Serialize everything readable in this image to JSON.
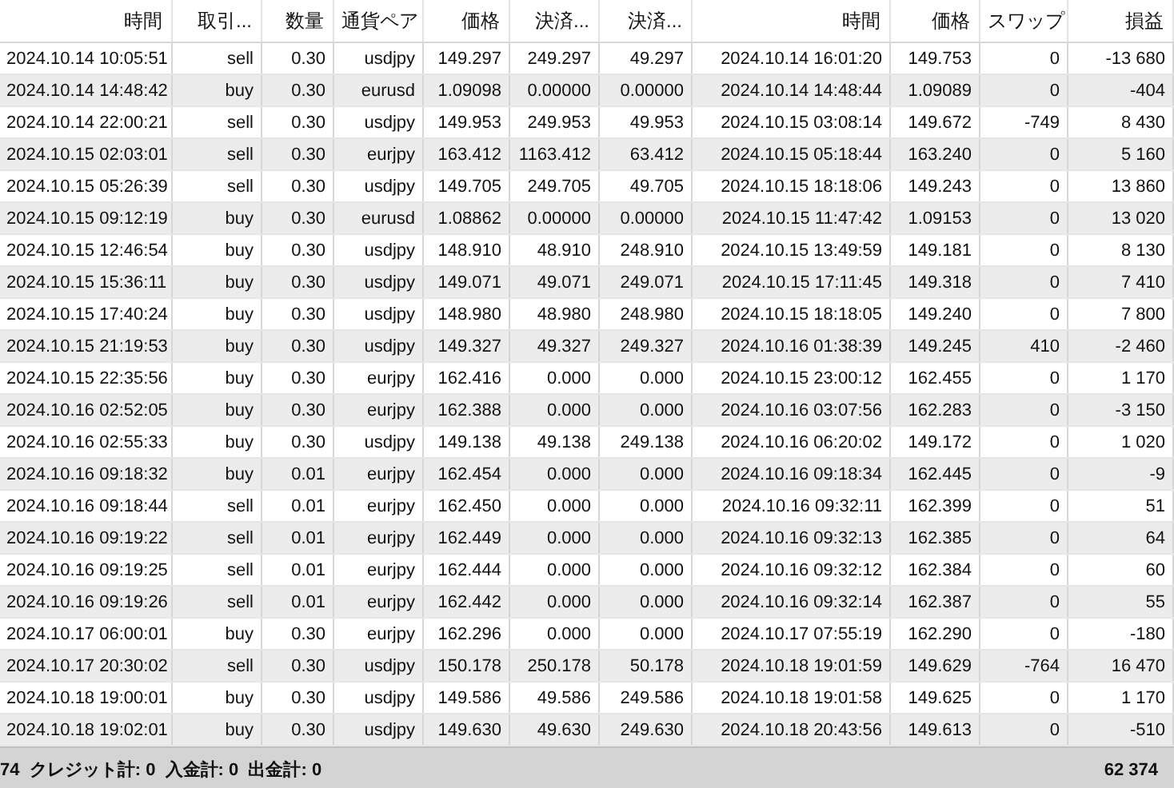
{
  "table": {
    "columns": [
      "時間",
      "取引...",
      "数量",
      "通貨ペア",
      "価格",
      "決済...",
      "決済...",
      "時間",
      "価格",
      "スワップ",
      "損益"
    ],
    "rows": [
      [
        "2024.10.14 10:05:51",
        "sell",
        "0.30",
        "usdjpy",
        "149.297",
        "249.297",
        "49.297",
        "2024.10.14 16:01:20",
        "149.753",
        "0",
        "-13 680"
      ],
      [
        "2024.10.14 14:48:42",
        "buy",
        "0.30",
        "eurusd",
        "1.09098",
        "0.00000",
        "0.00000",
        "2024.10.14 14:48:44",
        "1.09089",
        "0",
        "-404"
      ],
      [
        "2024.10.14 22:00:21",
        "sell",
        "0.30",
        "usdjpy",
        "149.953",
        "249.953",
        "49.953",
        "2024.10.15 03:08:14",
        "149.672",
        "-749",
        "8 430"
      ],
      [
        "2024.10.15 02:03:01",
        "sell",
        "0.30",
        "eurjpy",
        "163.412",
        "1163.412",
        "63.412",
        "2024.10.15 05:18:44",
        "163.240",
        "0",
        "5 160"
      ],
      [
        "2024.10.15 05:26:39",
        "sell",
        "0.30",
        "usdjpy",
        "149.705",
        "249.705",
        "49.705",
        "2024.10.15 18:18:06",
        "149.243",
        "0",
        "13 860"
      ],
      [
        "2024.10.15 09:12:19",
        "buy",
        "0.30",
        "eurusd",
        "1.08862",
        "0.00000",
        "0.00000",
        "2024.10.15 11:47:42",
        "1.09153",
        "0",
        "13 020"
      ],
      [
        "2024.10.15 12:46:54",
        "buy",
        "0.30",
        "usdjpy",
        "148.910",
        "48.910",
        "248.910",
        "2024.10.15 13:49:59",
        "149.181",
        "0",
        "8 130"
      ],
      [
        "2024.10.15 15:36:11",
        "buy",
        "0.30",
        "usdjpy",
        "149.071",
        "49.071",
        "249.071",
        "2024.10.15 17:11:45",
        "149.318",
        "0",
        "7 410"
      ],
      [
        "2024.10.15 17:40:24",
        "buy",
        "0.30",
        "usdjpy",
        "148.980",
        "48.980",
        "248.980",
        "2024.10.15 18:18:05",
        "149.240",
        "0",
        "7 800"
      ],
      [
        "2024.10.15 21:19:53",
        "buy",
        "0.30",
        "usdjpy",
        "149.327",
        "49.327",
        "249.327",
        "2024.10.16 01:38:39",
        "149.245",
        "410",
        "-2 460"
      ],
      [
        "2024.10.15 22:35:56",
        "buy",
        "0.30",
        "eurjpy",
        "162.416",
        "0.000",
        "0.000",
        "2024.10.15 23:00:12",
        "162.455",
        "0",
        "1 170"
      ],
      [
        "2024.10.16 02:52:05",
        "buy",
        "0.30",
        "eurjpy",
        "162.388",
        "0.000",
        "0.000",
        "2024.10.16 03:07:56",
        "162.283",
        "0",
        "-3 150"
      ],
      [
        "2024.10.16 02:55:33",
        "buy",
        "0.30",
        "usdjpy",
        "149.138",
        "49.138",
        "249.138",
        "2024.10.16 06:20:02",
        "149.172",
        "0",
        "1 020"
      ],
      [
        "2024.10.16 09:18:32",
        "buy",
        "0.01",
        "eurjpy",
        "162.454",
        "0.000",
        "0.000",
        "2024.10.16 09:18:34",
        "162.445",
        "0",
        "-9"
      ],
      [
        "2024.10.16 09:18:44",
        "sell",
        "0.01",
        "eurjpy",
        "162.450",
        "0.000",
        "0.000",
        "2024.10.16 09:32:11",
        "162.399",
        "0",
        "51"
      ],
      [
        "2024.10.16 09:19:22",
        "sell",
        "0.01",
        "eurjpy",
        "162.449",
        "0.000",
        "0.000",
        "2024.10.16 09:32:13",
        "162.385",
        "0",
        "64"
      ],
      [
        "2024.10.16 09:19:25",
        "sell",
        "0.01",
        "eurjpy",
        "162.444",
        "0.000",
        "0.000",
        "2024.10.16 09:32:12",
        "162.384",
        "0",
        "60"
      ],
      [
        "2024.10.16 09:19:26",
        "sell",
        "0.01",
        "eurjpy",
        "162.442",
        "0.000",
        "0.000",
        "2024.10.16 09:32:14",
        "162.387",
        "0",
        "55"
      ],
      [
        "2024.10.17 06:00:01",
        "buy",
        "0.30",
        "eurjpy",
        "162.296",
        "0.000",
        "0.000",
        "2024.10.17 07:55:19",
        "162.290",
        "0",
        "-180"
      ],
      [
        "2024.10.17 20:30:02",
        "sell",
        "0.30",
        "usdjpy",
        "150.178",
        "250.178",
        "50.178",
        "2024.10.18 19:01:59",
        "149.629",
        "-764",
        "16 470"
      ],
      [
        "2024.10.18 19:00:01",
        "buy",
        "0.30",
        "usdjpy",
        "149.586",
        "49.586",
        "249.586",
        "2024.10.18 19:01:58",
        "149.625",
        "0",
        "1 170"
      ],
      [
        "2024.10.18 19:02:01",
        "buy",
        "0.30",
        "usdjpy",
        "149.630",
        "49.630",
        "249.630",
        "2024.10.18 20:43:56",
        "149.613",
        "0",
        "-510"
      ]
    ]
  },
  "summary_bar": {
    "text": "74  クレジット計: 0  入金計: 0  出金計: 0",
    "total": "62 374"
  }
}
